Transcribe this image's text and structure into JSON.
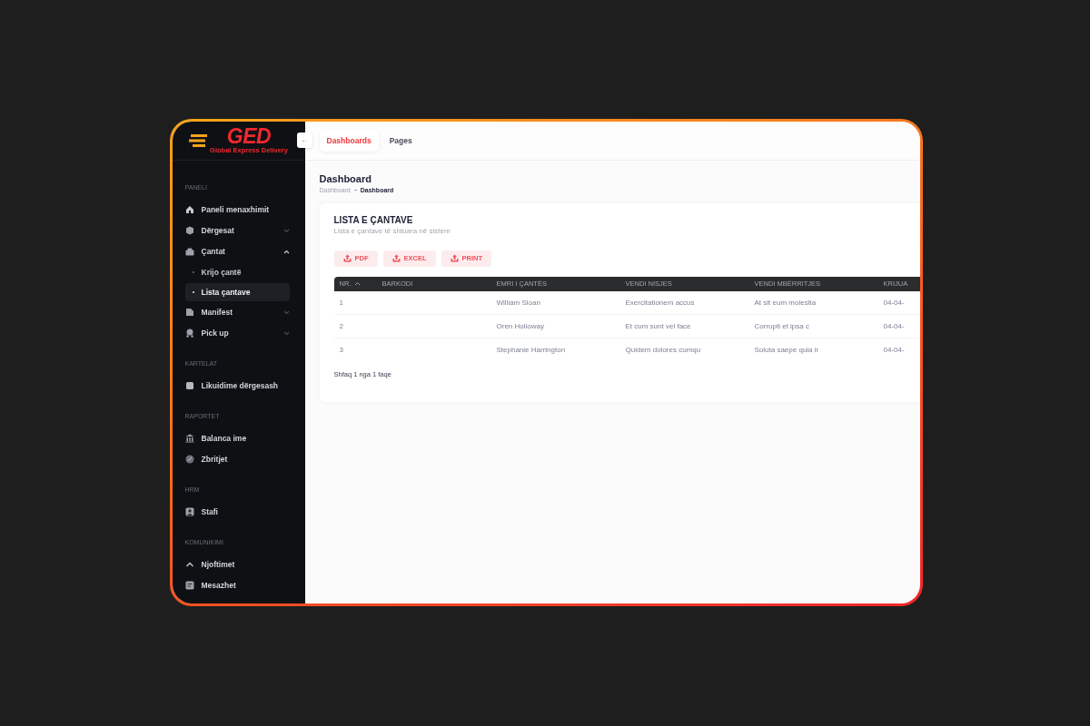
{
  "logo": {
    "text": "GED",
    "tagline": "Global Express Delivery"
  },
  "sidebar": {
    "sections": [
      {
        "title": "PANELI",
        "items": [
          {
            "label": "Paneli menaxhimit"
          },
          {
            "label": "Dërgesat",
            "expanded": false
          },
          {
            "label": "Çantat",
            "expanded": true,
            "children": [
              {
                "label": "Krijo çantë",
                "selected": false
              },
              {
                "label": "Lista çantave",
                "selected": true
              }
            ]
          },
          {
            "label": "Manifest",
            "expanded": false
          },
          {
            "label": "Pick up",
            "expanded": false
          }
        ]
      },
      {
        "title": "KARTELAT",
        "items": [
          {
            "label": "Likuidime dërgesash"
          }
        ]
      },
      {
        "title": "RAPORTET",
        "items": [
          {
            "label": "Balanca ime"
          },
          {
            "label": "Zbritjet"
          }
        ]
      },
      {
        "title": "HRM",
        "items": [
          {
            "label": "Stafi"
          }
        ]
      },
      {
        "title": "KOMUNIKIMI",
        "items": [
          {
            "label": "Njoftimet"
          },
          {
            "label": "Mesazhet"
          }
        ]
      }
    ]
  },
  "collapse_button": "←",
  "tabs": [
    {
      "label": "Dashboards",
      "selected": true
    },
    {
      "label": "Pages",
      "selected": false
    }
  ],
  "page_title": "Dashboard",
  "breadcrumb": [
    "Dashboard",
    "Dashboard"
  ],
  "card": {
    "title": "LISTA E ÇANTAVE",
    "subtitle": "Lista e çantave të shtuara në sistem",
    "buttons": [
      "PDF",
      "EXCEL",
      "PRINT"
    ],
    "table": {
      "columns": [
        "NR.",
        "BARKODI",
        "EMRI I ÇANTËS",
        "VENDI NISJES",
        "VENDI MBËRRITJES",
        "KRIJUA"
      ],
      "rows": [
        [
          "1",
          "",
          "William Sloan",
          "Exercitationem accus",
          "At sit eum molestia",
          "04-04-"
        ],
        [
          "2",
          "",
          "Oren Holloway",
          "Et cum sunt vel face",
          "Corrupti et ipsa c",
          "04-04-"
        ],
        [
          "3",
          "",
          "Stephanie Harrington",
          "Quidem dolores cumqu",
          "Soluta saepe quia ir",
          "04-04-"
        ]
      ]
    },
    "footer": "Shfaq 1 nga 1 faqe"
  }
}
